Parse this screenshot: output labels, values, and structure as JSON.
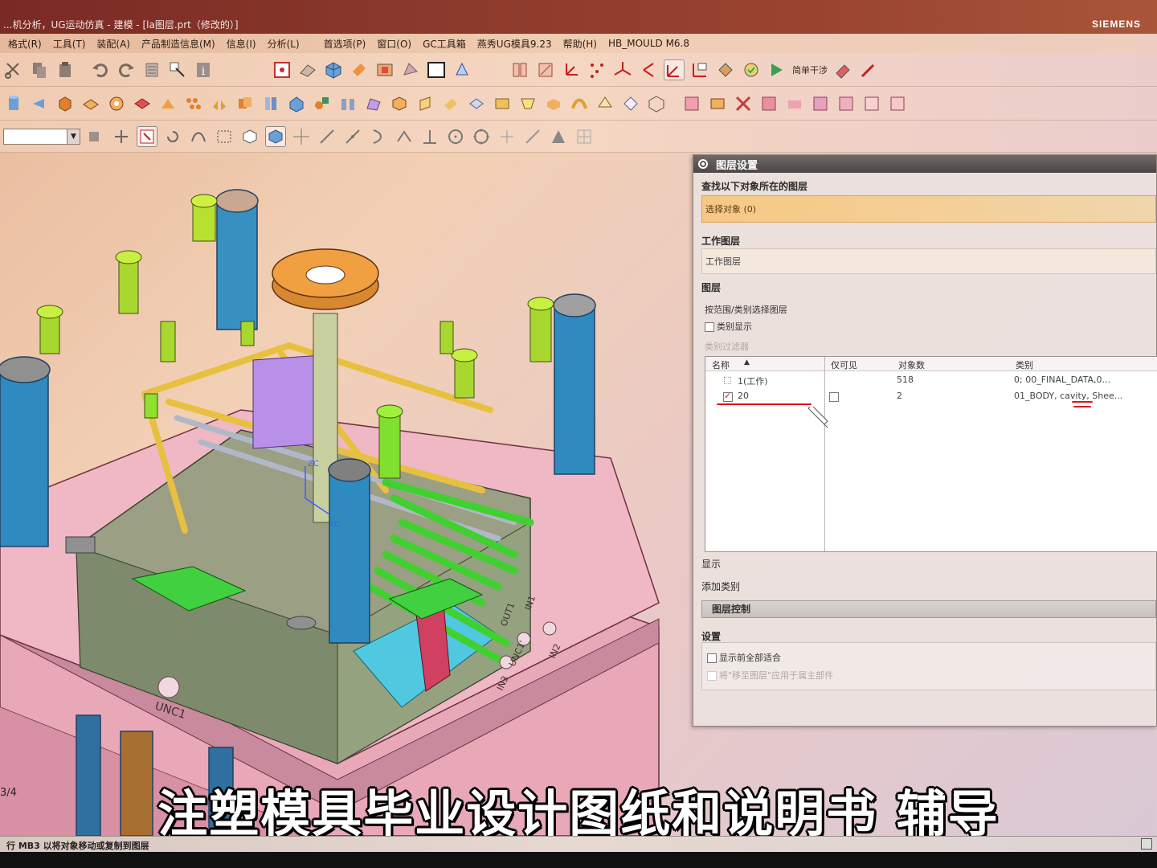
{
  "titlebar": {
    "title": "...机分析，UG运动仿真 - 建模 - [la图层.prt（修改的）]",
    "brand": "SIEMENS"
  },
  "menubar": {
    "items": [
      "格式(R)",
      "工具(T)",
      "装配(A)",
      "产品制造信息(M)",
      "信息(I)",
      "分析(L)",
      "首选项(P)",
      "窗口(O)",
      "GC工具箱",
      "燕秀UG模具9.23",
      "帮助(H)",
      "HB_MOULD M6.8"
    ]
  },
  "toolbar": {
    "simple_label": "简单干涉"
  },
  "dialog": {
    "title": "图层设置",
    "find_label": "查找以下对象所在的图层",
    "select_object": "选择对象 (0)",
    "work_layer_group": "工作图层",
    "work_layer_field": "工作图层",
    "layer_group": "图层",
    "select_by_range": "按范围/类别选择图层",
    "category_display": "类别显示",
    "category_filter": "类别过滤器",
    "table": {
      "headers": [
        "名称",
        "仅可见",
        "对象数",
        "类别"
      ],
      "rows": [
        {
          "name": "1(工作)",
          "visible_only": "",
          "count": "518",
          "category": "0; 00_FINAL_DATA,0..."
        },
        {
          "name": "20",
          "visible_only": "",
          "count": "2",
          "category": "01_BODY, cavity, Shee..."
        }
      ]
    },
    "display_label": "显示",
    "add_category_label": "添加类别",
    "layer_control": "图层控制",
    "settings_group": "设置",
    "fit_all_before_display": "显示前全部适合",
    "apply_move_layer": "将\"移至图层\"应用于属主部件"
  },
  "viewport": {
    "labels": [
      "UNC1",
      "OUT1",
      "IN1",
      "UNC1'",
      "IN2",
      "IN3",
      "XC",
      "ZC",
      "3/4"
    ]
  },
  "statusbar": {
    "text": "行 MB3 以将对象移动或复制到图层"
  },
  "subtitle": "注塑模具毕业设计图纸和说明书 辅导",
  "colors": {
    "titlebar": "#8c3a2c",
    "selection_field": "#f6c883",
    "annotation_red": "#e01020",
    "subtitle_text": "#ffffff"
  }
}
